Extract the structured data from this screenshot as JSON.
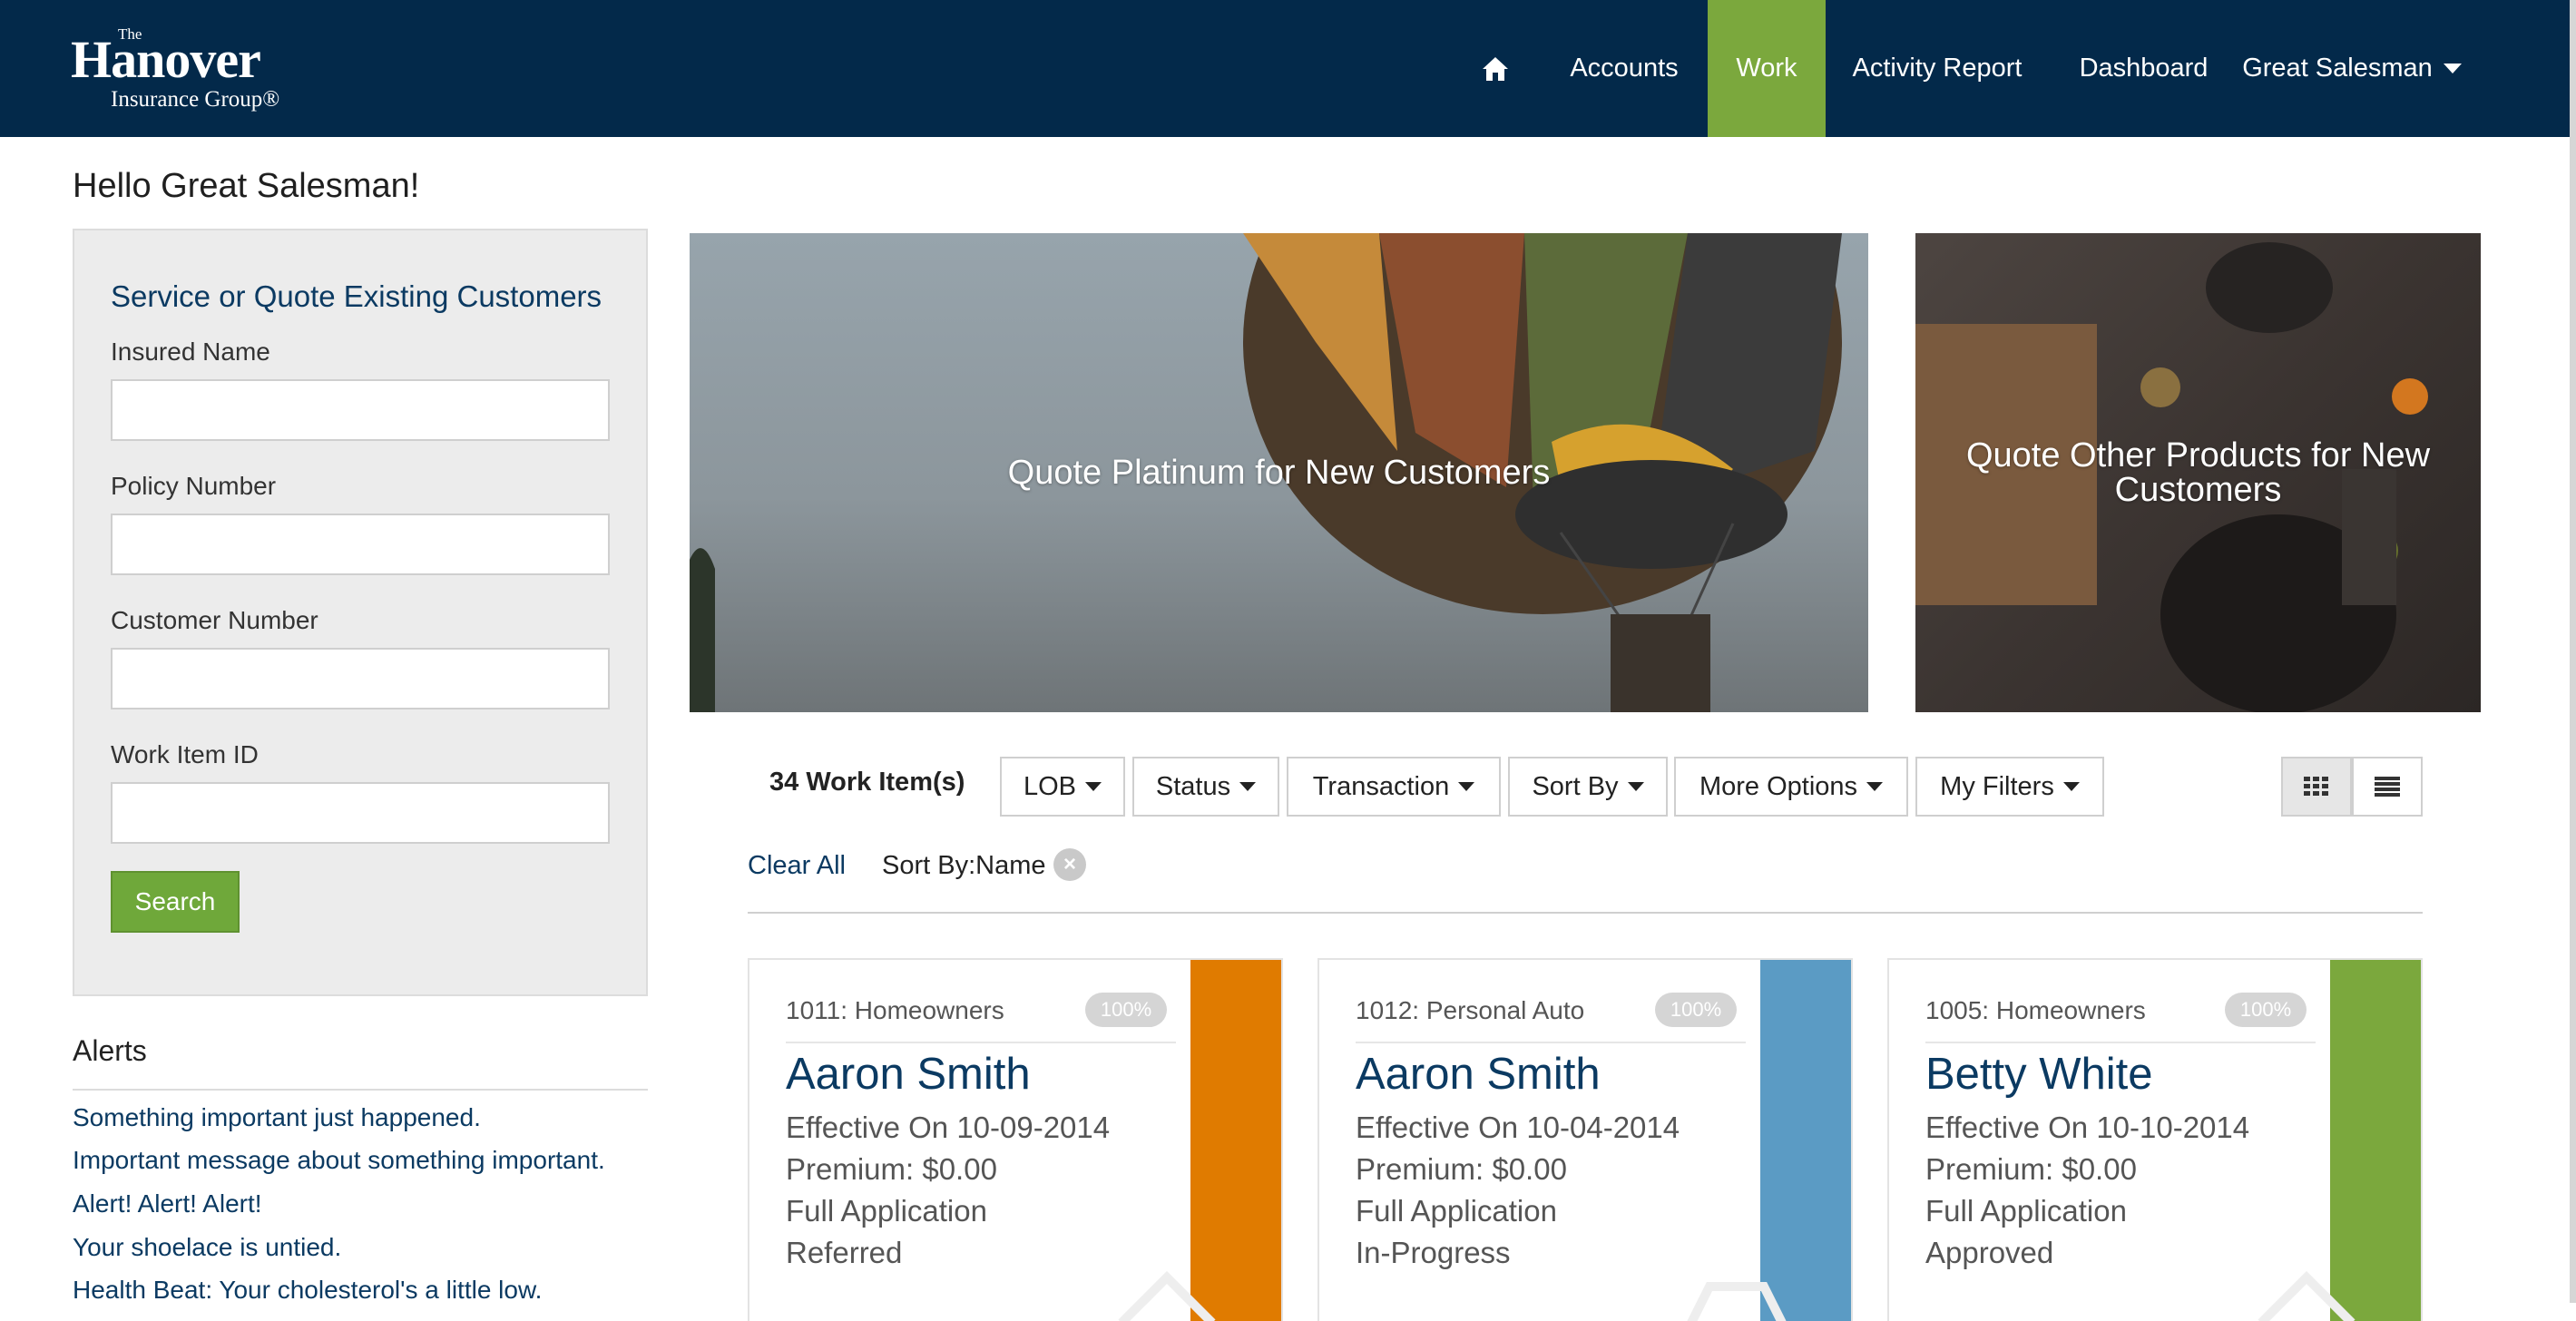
{
  "header": {
    "logo": {
      "the": "The",
      "name": "Hanover",
      "sub": "Insurance Group®"
    },
    "nav": {
      "home_icon": "home-icon",
      "accounts": "Accounts",
      "work": "Work",
      "activity_report": "Activity Report",
      "dashboard": "Dashboard",
      "user": "Great Salesman"
    }
  },
  "colors": {
    "navy": "#03294a",
    "green": "#7ba83d",
    "orange": "#e07b00",
    "blue": "#5b9bc4"
  },
  "greeting": "Hello Great Salesman!",
  "search": {
    "title": "Service or Quote Existing Customers",
    "insured_name_label": "Insured Name",
    "insured_name_value": "",
    "policy_number_label": "Policy Number",
    "policy_number_value": "",
    "customer_number_label": "Customer Number",
    "customer_number_value": "",
    "work_item_id_label": "Work Item ID",
    "work_item_id_value": "",
    "button": "Search"
  },
  "alerts": {
    "title": "Alerts",
    "items": [
      "Something important just happened.",
      "Important message about something important.",
      "Alert! Alert! Alert!",
      "Your shoelace is untied.",
      "Health Beat: Your cholesterol's a little low."
    ]
  },
  "promos": {
    "platinum": "Quote Platinum for New Customers",
    "other_line1": "Quote Other Products for New",
    "other_line2": "Customers"
  },
  "toolbar": {
    "count": "34 Work Item(s)",
    "filters": [
      "LOB",
      "Status",
      "Transaction",
      "Sort By",
      "More Options",
      "My Filters"
    ],
    "view_grid_icon": "grid-view-icon",
    "view_list_icon": "list-view-icon",
    "clear_all": "Clear All",
    "sort_chip": "Sort By:Name"
  },
  "cards": [
    {
      "head": "1011: Homeowners",
      "progress": "100%",
      "name": "Aaron Smith",
      "effective": "Effective On 10-09-2014",
      "premium": "Premium: $0.00",
      "type": "Full Application",
      "status": "Referred",
      "status_color": "#e07b00"
    },
    {
      "head": "1012: Personal Auto",
      "progress": "100%",
      "name": "Aaron Smith",
      "effective": "Effective On 10-04-2014",
      "premium": "Premium: $0.00",
      "type": "Full Application",
      "status": "In-Progress",
      "status_color": "#5b9bc4"
    },
    {
      "head": "1005: Homeowners",
      "progress": "100%",
      "name": "Betty White",
      "effective": "Effective On 10-10-2014",
      "premium": "Premium: $0.00",
      "type": "Full Application",
      "status": "Approved",
      "status_color": "#7ba83d"
    }
  ]
}
